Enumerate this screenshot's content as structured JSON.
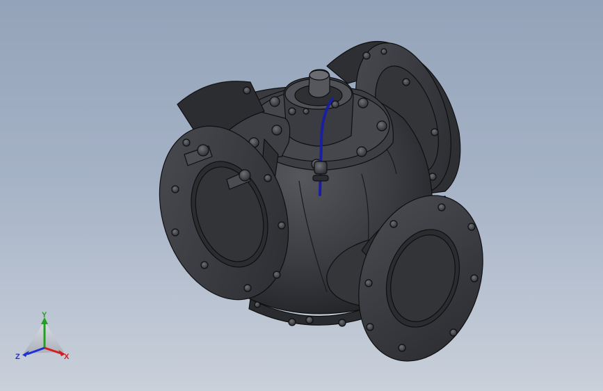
{
  "viewport": {
    "background_top": "#94a3b9",
    "background_bottom": "#c9d0da"
  },
  "model": {
    "name": "",
    "body_color": "#3a3b3f",
    "edge_color": "#0f0f10",
    "highlight_color": "#5a5c62",
    "cable_color": "#1a1fa0"
  },
  "triad": {
    "x_label": "X",
    "y_label": "Y",
    "z_label": "Z",
    "x_color": "#d11f1f",
    "y_color": "#1fa31f",
    "z_color": "#1f2fd1"
  }
}
